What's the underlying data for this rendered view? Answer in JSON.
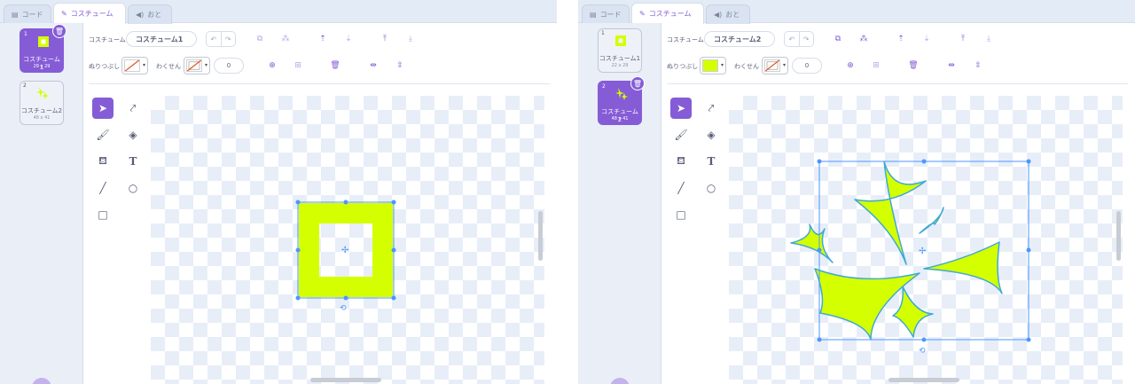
{
  "tabs": [
    {
      "label": "コード",
      "icon": "code-icon"
    },
    {
      "label": "コスチューム",
      "icon": "brush-icon"
    },
    {
      "label": "おと",
      "icon": "speaker-icon"
    }
  ],
  "left_panel": {
    "costumes": [
      {
        "number": "1",
        "name": "コスチューム1",
        "size": "29 x 29",
        "selected": true
      },
      {
        "number": "2",
        "name": "コスチューム2",
        "size": "48 x 41",
        "selected": false
      }
    ],
    "editor": {
      "costume_label": "コスチューム",
      "costume_name": "コスチューム1",
      "fill_label": "ぬりつぶし",
      "outline_label": "わくせん",
      "outline_width": "0",
      "fill_color": "#ffffff",
      "shape_color": "#d4ff00"
    }
  },
  "right_panel": {
    "costumes": [
      {
        "number": "1",
        "name": "コスチューム1",
        "size": "22 x 29",
        "selected": false
      },
      {
        "number": "2",
        "name": "コスチューム2",
        "size": "48 x 41",
        "selected": true
      }
    ],
    "editor": {
      "costume_label": "コスチューム",
      "costume_name": "コスチューム2",
      "fill_label": "ぬりつぶし",
      "outline_label": "わくせん",
      "outline_width": "0",
      "fill_color": "#d4ff00",
      "shape_color": "#d4ff00"
    }
  },
  "colors": {
    "accent": "#855cd6",
    "selection": "#4c97ff",
    "sparkle_outline": "#3fa9d6"
  }
}
